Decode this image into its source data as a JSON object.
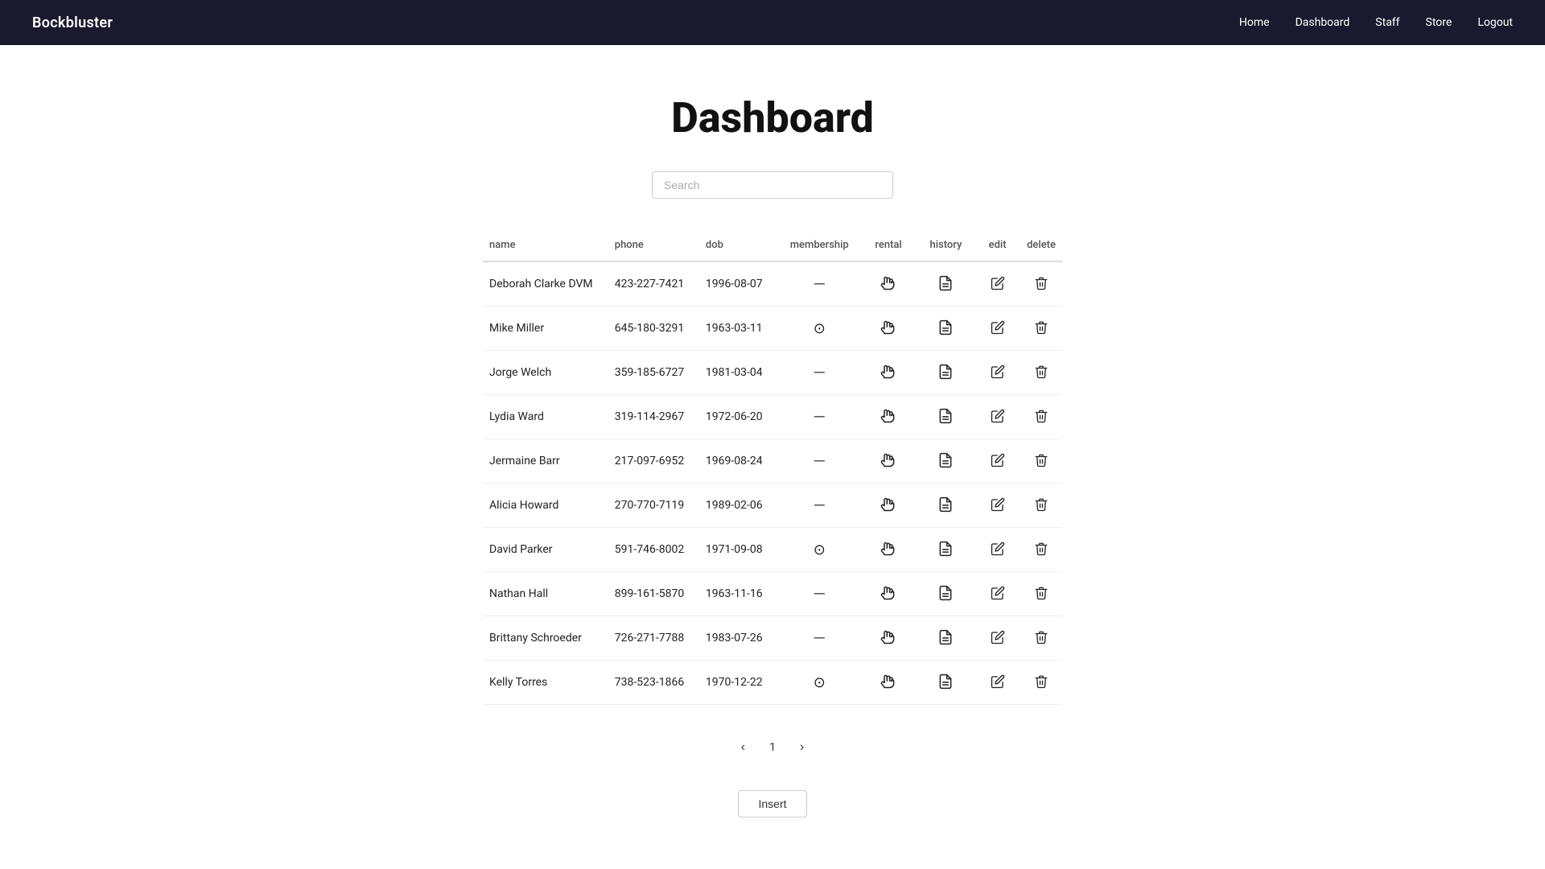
{
  "brand": "Bockbluster",
  "nav": {
    "links": [
      {
        "label": "Home",
        "name": "home"
      },
      {
        "label": "Dashboard",
        "name": "dashboard"
      },
      {
        "label": "Staff",
        "name": "staff"
      },
      {
        "label": "Store",
        "name": "store"
      },
      {
        "label": "Logout",
        "name": "logout"
      }
    ]
  },
  "page_title": "Dashboard",
  "search": {
    "placeholder": "Search"
  },
  "table": {
    "columns": [
      "name",
      "phone",
      "dob",
      "membership",
      "rental",
      "history",
      "edit",
      "delete"
    ],
    "rows": [
      {
        "name": "Deborah Clarke DVM",
        "phone": "423-227-7421",
        "dob": "1996-08-07",
        "membership": "dash",
        "has_rental": true,
        "has_history": true
      },
      {
        "name": "Mike Miller",
        "phone": "645-180-3291",
        "dob": "1963-03-11",
        "membership": "check",
        "has_rental": true,
        "has_history": true
      },
      {
        "name": "Jorge Welch",
        "phone": "359-185-6727",
        "dob": "1981-03-04",
        "membership": "dash",
        "has_rental": true,
        "has_history": true
      },
      {
        "name": "Lydia Ward",
        "phone": "319-114-2967",
        "dob": "1972-06-20",
        "membership": "dash",
        "has_rental": true,
        "has_history": true
      },
      {
        "name": "Jermaine Barr",
        "phone": "217-097-6952",
        "dob": "1969-08-24",
        "membership": "dash",
        "has_rental": true,
        "has_history": true
      },
      {
        "name": "Alicia Howard",
        "phone": "270-770-7119",
        "dob": "1989-02-06",
        "membership": "dash",
        "has_rental": true,
        "has_history": true
      },
      {
        "name": "David Parker",
        "phone": "591-746-8002",
        "dob": "1971-09-08",
        "membership": "check",
        "has_rental": true,
        "has_history": true
      },
      {
        "name": "Nathan Hall",
        "phone": "899-161-5870",
        "dob": "1963-11-16",
        "membership": "dash",
        "has_rental": true,
        "has_history": true
      },
      {
        "name": "Brittany Schroeder",
        "phone": "726-271-7788",
        "dob": "1983-07-26",
        "membership": "dash",
        "has_rental": true,
        "has_history": true
      },
      {
        "name": "Kelly Torres",
        "phone": "738-523-1866",
        "dob": "1970-12-22",
        "membership": "check",
        "has_rental": true,
        "has_history": true
      }
    ]
  },
  "pagination": {
    "prev_label": "‹",
    "next_label": "›",
    "current_page": "1"
  },
  "insert_label": "Insert"
}
